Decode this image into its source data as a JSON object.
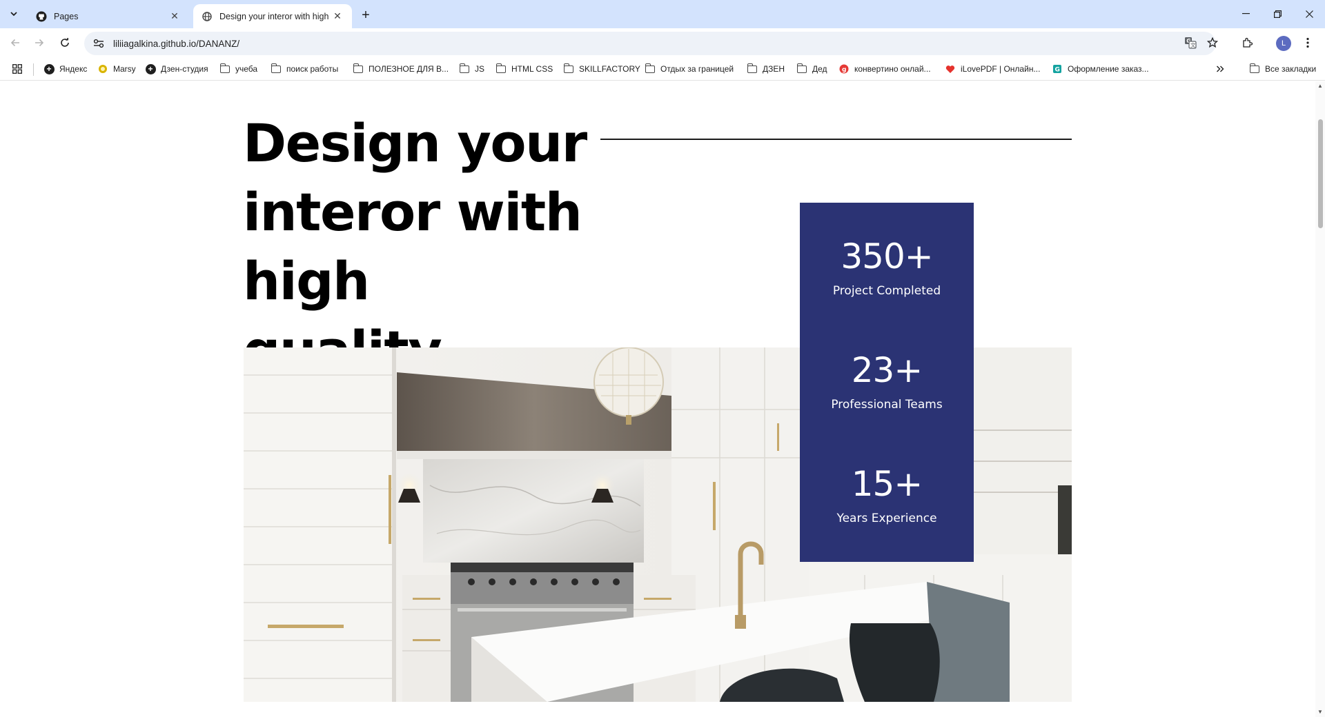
{
  "browser": {
    "tabs": [
      {
        "title": "Pages",
        "active": false
      },
      {
        "title": "Design your interor with high q",
        "active": true
      }
    ],
    "url": "liliiagalkina.github.io/DANANZ/",
    "profile_initial": "L",
    "bookmarks": [
      {
        "label": "Яндекс",
        "icon": "plus-circle-icon"
      },
      {
        "label": "Marsy",
        "icon": "marsy-icon"
      },
      {
        "label": "Дзен-студия",
        "icon": "plus-circle-icon"
      },
      {
        "label": "учеба",
        "icon": "folder-icon"
      },
      {
        "label": "поиск работы",
        "icon": "folder-icon"
      },
      {
        "label": "ПОЛЕЗНОЕ ДЛЯ В...",
        "icon": "folder-icon"
      },
      {
        "label": "JS",
        "icon": "folder-icon"
      },
      {
        "label": "HTML CSS",
        "icon": "folder-icon"
      },
      {
        "label": "SKILLFACTORY",
        "icon": "folder-icon"
      },
      {
        "label": "Отдых за границей",
        "icon": "folder-icon"
      },
      {
        "label": "ДЗЕН",
        "icon": "folder-icon"
      },
      {
        "label": "Дед",
        "icon": "folder-icon"
      },
      {
        "label": "конвертино онлай...",
        "icon": "convertio-icon"
      },
      {
        "label": "iLovePDF | Онлайн...",
        "icon": "ilovepdf-icon"
      },
      {
        "label": "Оформление заказ...",
        "icon": "order-icon"
      }
    ],
    "all_bookmarks_label": "Все закладки"
  },
  "page": {
    "hero": {
      "line1": "Design your",
      "line2": "interor with high",
      "line3": "quality."
    },
    "stats": [
      {
        "value": "350+",
        "label": "Project Completed"
      },
      {
        "value": "23+",
        "label": "Professional Teams"
      },
      {
        "value": "15+",
        "label": "Years Experience"
      }
    ],
    "colors": {
      "stats_bg": "#2b3374",
      "tabstrip_bg": "#d3e3fd"
    }
  }
}
